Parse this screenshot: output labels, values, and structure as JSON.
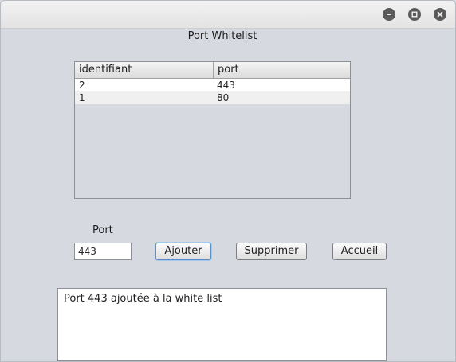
{
  "window": {
    "title": "Port Whitelist"
  },
  "window_controls": {
    "minimize_icon": "minus-icon",
    "maximize_icon": "square-icon",
    "close_icon": "close-icon"
  },
  "table": {
    "columns": [
      "identifiant",
      "port"
    ],
    "rows": [
      [
        "2",
        "443"
      ],
      [
        "1",
        "80"
      ]
    ]
  },
  "form": {
    "port_label": "Port",
    "port_value": "443",
    "add_label": "Ajouter",
    "delete_label": "Supprimer",
    "home_label": "Accueil"
  },
  "message": {
    "text": "Port 443 ajoutée à la white list"
  },
  "colors": {
    "window_bg": "#d6d9df",
    "focus_ring": "#5b8fc8"
  }
}
